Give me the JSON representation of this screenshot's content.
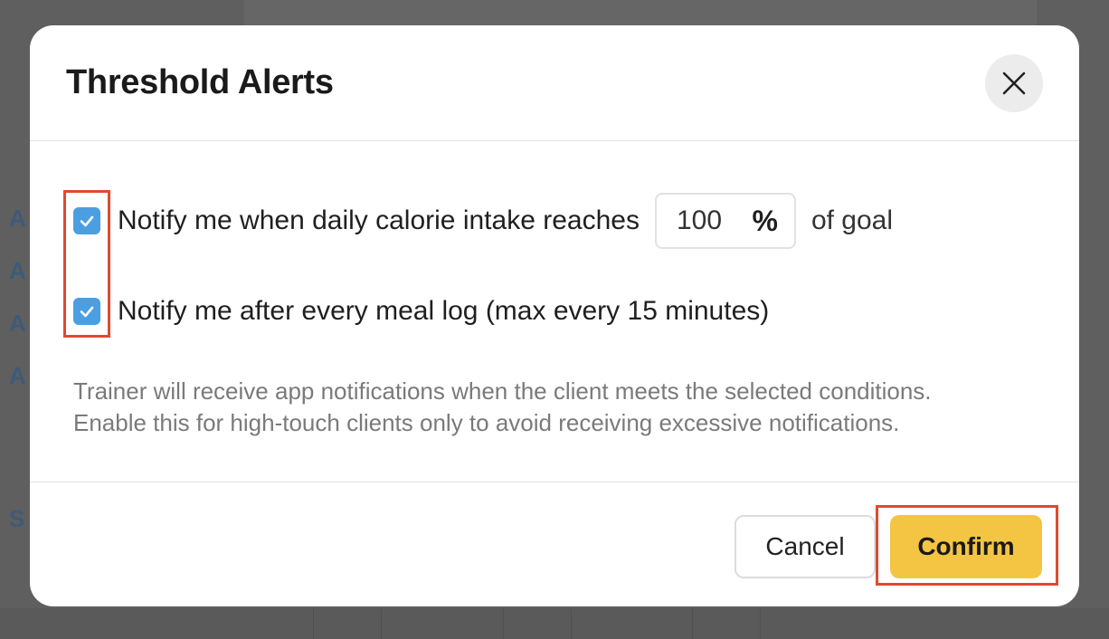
{
  "modal": {
    "title": "Threshold Alerts",
    "close_icon": "close-icon",
    "options": [
      {
        "label": "Notify me when daily calorie intake reaches",
        "checked": true,
        "input_value": "100",
        "input_unit": "%",
        "suffix": "of goal"
      },
      {
        "label": "Notify me after every meal log (max every 15 minutes)",
        "checked": true
      }
    ],
    "help_lines": [
      "Trainer will receive app notifications when the client meets the selected conditions.",
      "Enable this for high-touch clients only to avoid receiving excessive notifications."
    ],
    "cancel_label": "Cancel",
    "confirm_label": "Confirm"
  },
  "colors": {
    "checkbox": "#4b9fe1",
    "confirm": "#f4c542",
    "highlight": "#e04a2f"
  }
}
